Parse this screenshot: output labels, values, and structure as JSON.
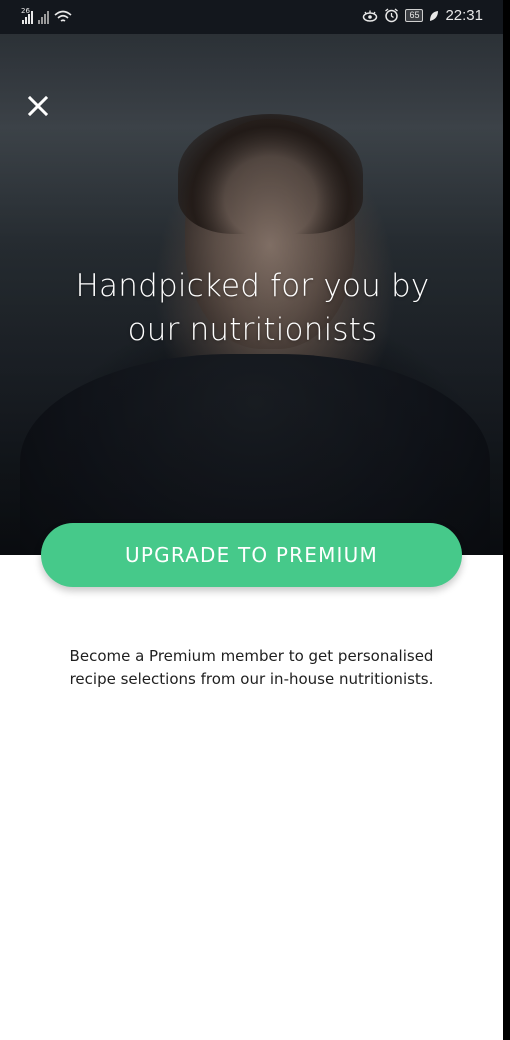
{
  "status_bar": {
    "network_label": "26",
    "time": "22:31",
    "battery_level": "65",
    "icons": [
      "signal-icon",
      "signal-icon-dim",
      "wifi-icon",
      "eye-comfort-icon",
      "alarm-icon",
      "battery-icon",
      "leaf-icon"
    ]
  },
  "hero": {
    "title_line1": "Handpicked for you by",
    "title_line2": "our nutritionists",
    "close_icon": "close-icon"
  },
  "cta": {
    "upgrade_label": "UPGRADE TO PREMIUM",
    "color": "#46c98a"
  },
  "body": {
    "description_line1": "Become a Premium member to get personalised",
    "description_line2": "recipe selections from our in-house nutritionists."
  }
}
